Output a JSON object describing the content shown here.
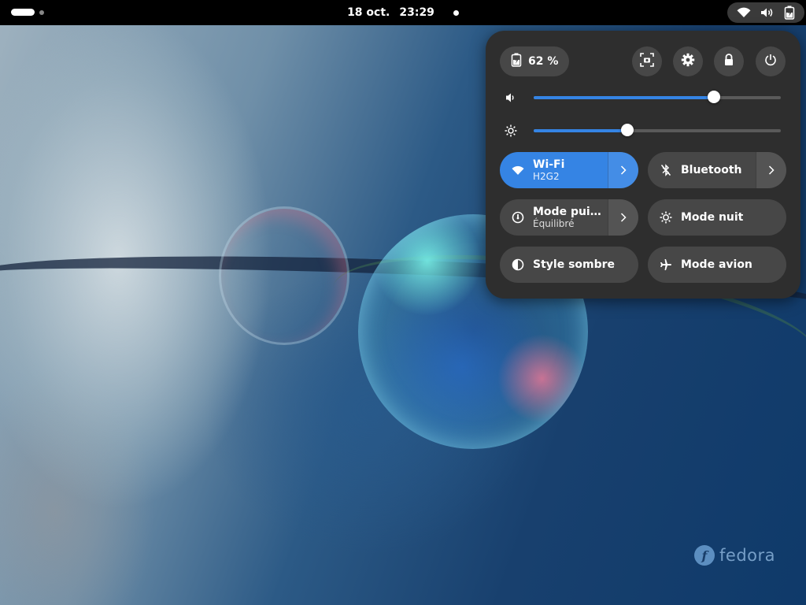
{
  "topbar": {
    "date": "18 oct.",
    "time": "23:29"
  },
  "status_icons": [
    "wifi-icon",
    "volume-icon",
    "battery-charging-icon"
  ],
  "quick_settings": {
    "battery_label": "62 %",
    "header_buttons": [
      "screenshot-icon",
      "gear-icon",
      "lock-icon",
      "power-icon"
    ],
    "volume_level": 0.73,
    "brightness_level": 0.38,
    "tiles": [
      {
        "id": "wifi",
        "title": "Wi-Fi",
        "subtitle": "H2G2",
        "active": true,
        "icon": "wifi-icon",
        "has_menu": true
      },
      {
        "id": "bluetooth",
        "title": "Bluetooth",
        "subtitle": "",
        "active": false,
        "icon": "bluetooth-disabled-icon",
        "has_menu": true
      },
      {
        "id": "power-mode",
        "title": "Mode puis…",
        "subtitle": "Équilibré",
        "active": false,
        "icon": "power-mode-icon",
        "has_menu": true
      },
      {
        "id": "night-light",
        "title": "Mode nuit",
        "subtitle": "",
        "active": false,
        "icon": "night-light-icon",
        "has_menu": false
      },
      {
        "id": "dark-style",
        "title": "Style sombre",
        "subtitle": "",
        "active": false,
        "icon": "dark-style-icon",
        "has_menu": false
      },
      {
        "id": "airplane",
        "title": "Mode avion",
        "subtitle": "",
        "active": false,
        "icon": "airplane-icon",
        "has_menu": false
      }
    ]
  },
  "wallpaper": {
    "logo_text": "fedora",
    "logo_mark": "f"
  },
  "colors": {
    "accent": "#3584e4",
    "panel": "#2e2e2e",
    "button": "#474747",
    "topbar": "#000000"
  }
}
